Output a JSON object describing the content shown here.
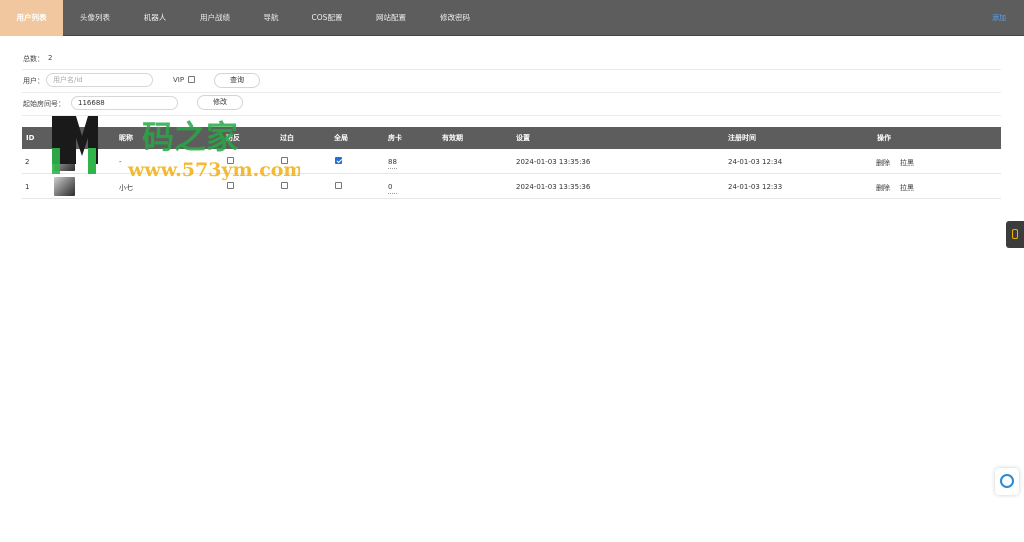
{
  "nav": {
    "tabs": [
      "用户列表",
      "头像列表",
      "机器人",
      "用户战绩",
      "导航",
      "COS配置",
      "网站配置",
      "修改密码"
    ],
    "active_index": 0,
    "right_link": "添加"
  },
  "summary": {
    "total_label": "总数：",
    "total_value": "2"
  },
  "filter": {
    "user_label": "用户：",
    "user_placeholder": "用户名/id",
    "vip_label": "VIP",
    "search_button": "查询"
  },
  "room": {
    "label": "起始房间号：",
    "value": "116688",
    "button": "修改"
  },
  "table": {
    "headers": [
      "ID",
      "昵称",
      "防反",
      "过白",
      "全局",
      "房卡",
      "有效期",
      "设置",
      "注册时间",
      "操作"
    ],
    "rows": [
      {
        "id": "2",
        "nickname": "-",
        "fangfan": false,
        "guobai": false,
        "quanju": true,
        "fangka": "88",
        "expiry": "",
        "setting": "2024-01-03 13:35:36",
        "register": "24-01-03 12:34",
        "op_delete": "删除",
        "op_block": "拉黑"
      },
      {
        "id": "1",
        "nickname": "小七",
        "fangfan": false,
        "guobai": false,
        "quanju": false,
        "fangka": "0",
        "expiry": "",
        "setting": "2024-01-03 13:35:36",
        "register": "24-01-03 12:33",
        "op_delete": "删除",
        "op_block": "拉黑"
      }
    ]
  },
  "watermark": {
    "cn": "码之家",
    "url": "www.573ym.com"
  },
  "colors": {
    "nav_bg": "#5d5d5d",
    "nav_active": "#f0c79f",
    "link": "#4ea6ff",
    "check": "#1e6fd9"
  },
  "icons": {
    "side_tab": "phone-icon",
    "float": "support-icon"
  }
}
